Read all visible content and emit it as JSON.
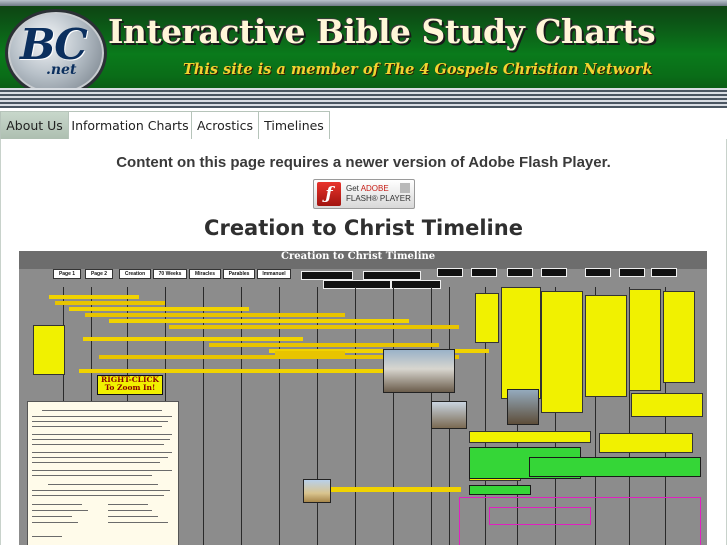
{
  "header": {
    "logo": "BC",
    "logo_suffix": ".net",
    "title": "Interactive Bible Study Charts",
    "subtitle": "This site is a member of The 4 Gospels Christian Network"
  },
  "nav": {
    "tabs": [
      {
        "label": "About Us",
        "active": true
      },
      {
        "label": "Information Charts",
        "active": false
      },
      {
        "label": "Acrostics",
        "active": false
      },
      {
        "label": "Timelines",
        "active": false
      }
    ]
  },
  "main": {
    "flash_message": "Content on this page requires a newer version of Adobe Flash Player.",
    "flash_button": {
      "get": "Get",
      "brand": "ADOBE",
      "product": "FLASH® PLAYER"
    },
    "chart_title": "Creation to Christ Timeline"
  },
  "timeline": {
    "title": "Creation to Christ Timeline",
    "right_click_label": "RIGHT-CLICK To Zoom In!",
    "buttons": [
      "Page 1",
      "Page 2",
      "Creation",
      "70 Weeks",
      "Miracles",
      "Parables",
      "Immanuel"
    ]
  },
  "colors": {
    "header_green": "#0a7a1b",
    "title_cream": "#fff6d8",
    "subtitle_gold": "#f2d330",
    "nav_active": "#bccbbf",
    "timeline_gray": "#8c8c8c",
    "timeline_yellow": "#f1f100",
    "timeline_green": "#35d637"
  },
  "icons": {
    "flash": "flash-logo-icon",
    "download": "download-arrow-icon"
  }
}
